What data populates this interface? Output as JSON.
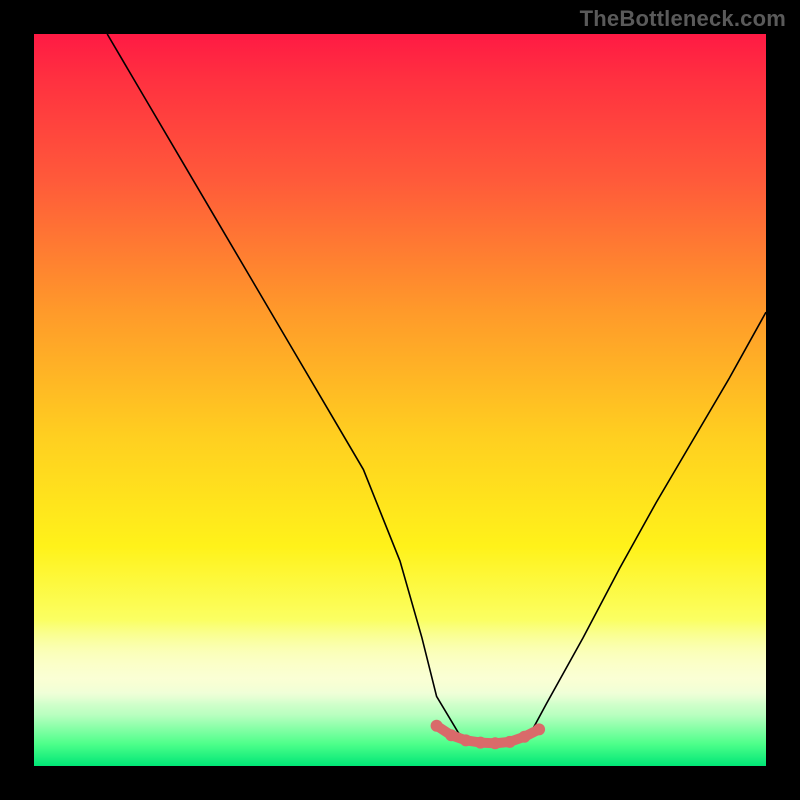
{
  "watermark": "TheBottleneck.com",
  "colors": {
    "background": "#000000",
    "curve": "#000000",
    "marker": "#d96a6a"
  },
  "chart_data": {
    "type": "line",
    "title": "",
    "xlabel": "",
    "ylabel": "",
    "xlim": [
      0,
      100
    ],
    "ylim": [
      0,
      100
    ],
    "grid": false,
    "legend": false,
    "series": [
      {
        "name": "bottleneck-curve",
        "x": [
          10,
          15,
          20,
          25,
          30,
          35,
          40,
          45,
          50,
          53,
          55,
          58,
          60,
          62,
          65,
          68,
          70,
          75,
          80,
          85,
          90,
          95,
          100
        ],
        "values": [
          100,
          91.5,
          83,
          74.5,
          66,
          57.5,
          49,
          40.5,
          28,
          17.5,
          9.5,
          4.5,
          3.2,
          3.0,
          3.2,
          4.8,
          8.5,
          17.5,
          27,
          36,
          44.5,
          53,
          62
        ]
      }
    ],
    "markers": {
      "name": "minimum-region",
      "x": [
        55,
        57,
        59,
        61,
        63,
        65,
        67,
        69
      ],
      "values": [
        5.5,
        4.2,
        3.5,
        3.2,
        3.1,
        3.3,
        4.0,
        5.0
      ]
    },
    "gradient_stops": [
      {
        "pos": 0,
        "color": "#ff1a44"
      },
      {
        "pos": 20,
        "color": "#ff5a3a"
      },
      {
        "pos": 55,
        "color": "#ffcf20"
      },
      {
        "pos": 80,
        "color": "#fbff62"
      },
      {
        "pos": 97,
        "color": "#4dff8a"
      },
      {
        "pos": 100,
        "color": "#00e676"
      }
    ]
  }
}
